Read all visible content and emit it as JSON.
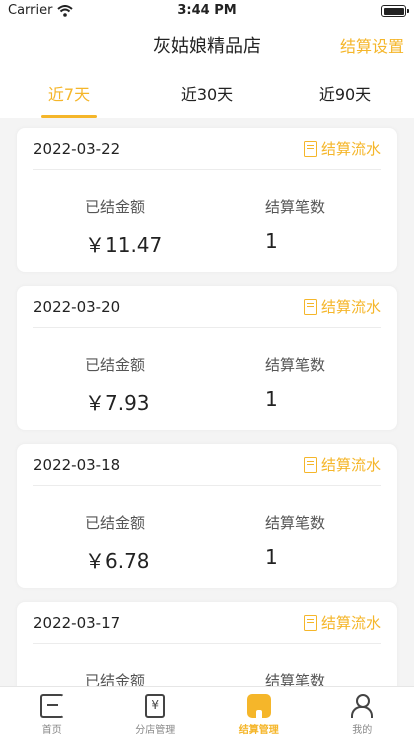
{
  "status_bar": {
    "carrier": "Carrier",
    "time": "3:44 PM",
    "battery_level": 1.0
  },
  "header": {
    "title": "灰姑娘精品店",
    "action_label": "结算设置"
  },
  "tabs": [
    {
      "label": "近7天",
      "active": true
    },
    {
      "label": "近30天",
      "active": false
    },
    {
      "label": "近90天",
      "active": false
    }
  ],
  "records": [
    {
      "date": "2022-03-22",
      "link": "结算流水",
      "amount_label": "已结金额",
      "amount": "￥11.47",
      "count_label": "结算笔数",
      "count": "1"
    },
    {
      "date": "2022-03-20",
      "link": "结算流水",
      "amount_label": "已结金额",
      "amount": "￥7.93",
      "count_label": "结算笔数",
      "count": "1"
    },
    {
      "date": "2022-03-18",
      "link": "结算流水",
      "amount_label": "已结金额",
      "amount": "￥6.78",
      "count_label": "结算笔数",
      "count": "1"
    },
    {
      "date": "2022-03-17",
      "link": "结算流水",
      "amount_label": "已结金额",
      "amount": "",
      "count_label": "结算笔数",
      "count": ""
    }
  ],
  "tabbar": [
    {
      "label": "首页",
      "icon": "home-icon",
      "active": false
    },
    {
      "label": "分店管理",
      "icon": "shop-ledger-icon",
      "active": false
    },
    {
      "label": "结算管理",
      "icon": "settlement-icon",
      "active": true
    },
    {
      "label": "我的",
      "icon": "user-icon",
      "active": false
    }
  ],
  "colors": {
    "accent": "#f5b62a",
    "background": "#f4f4f4"
  }
}
